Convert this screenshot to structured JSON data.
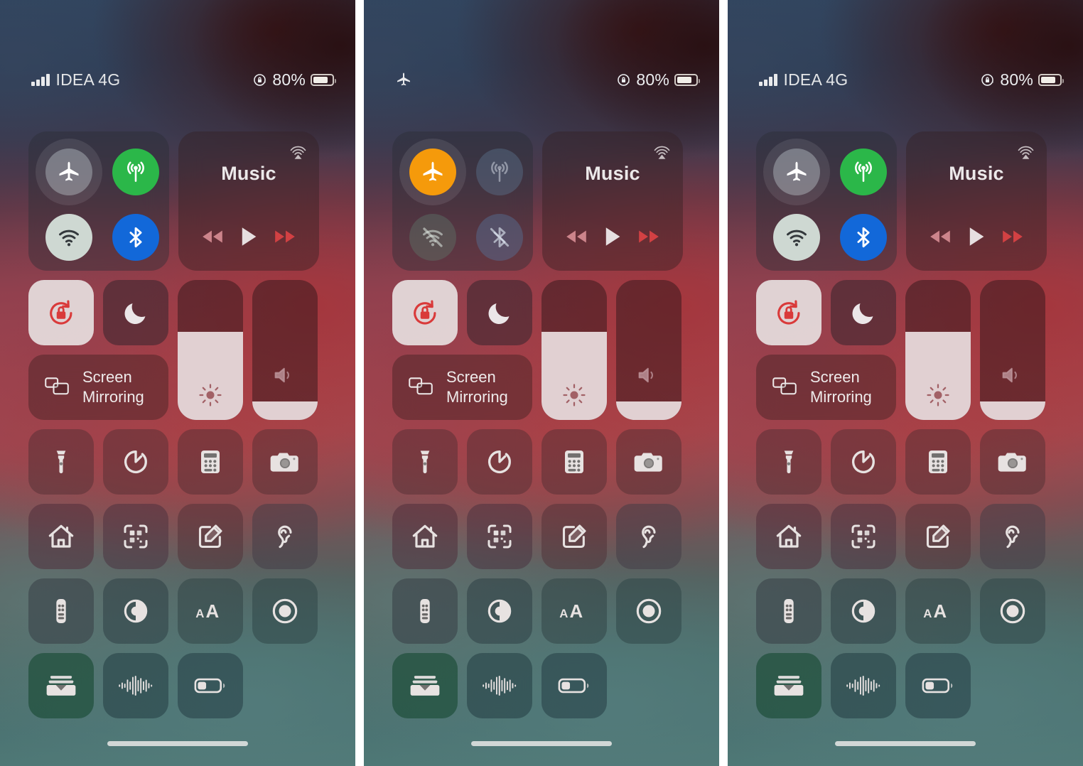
{
  "meta": {
    "title": "iOS Control Center — Airplane Mode states",
    "panel_count": 3
  },
  "colors": {
    "airplane_on": "#F59A0B",
    "cellular_on": "#2BB749",
    "wifi_on": "#ced8d2",
    "bluetooth_on": "#1268D9",
    "rotation_lock_red": "#D93A3A",
    "slider_fill": "#EEE2E4",
    "status_text": "#E9EAEC"
  },
  "panels": [
    {
      "id": "panel-before",
      "status_bar": {
        "carrier": "IDEA 4G",
        "signal_bars": 4,
        "show_airplane_icon": false,
        "rotation_lock_icon": "rotation-lock-icon",
        "battery_percent": "80%",
        "battery_fill": 80
      },
      "connectivity": {
        "airplane": {
          "label": "Airplane Mode",
          "state": "off",
          "icon": "airplane-icon"
        },
        "cellular": {
          "label": "Cellular Data",
          "state": "on",
          "icon": "cellular-icon"
        },
        "wifi": {
          "label": "Wi-Fi",
          "state": "on",
          "icon": "wifi-icon"
        },
        "bluetooth": {
          "label": "Bluetooth",
          "state": "on",
          "icon": "bluetooth-icon"
        }
      }
    },
    {
      "id": "panel-airplane-on",
      "status_bar": {
        "carrier": "",
        "signal_bars": 0,
        "show_airplane_icon": true,
        "rotation_lock_icon": "rotation-lock-icon",
        "battery_percent": "80%",
        "battery_fill": 80
      },
      "connectivity": {
        "airplane": {
          "label": "Airplane Mode",
          "state": "on",
          "icon": "airplane-icon"
        },
        "cellular": {
          "label": "Cellular Data",
          "state": "off",
          "icon": "cellular-icon"
        },
        "wifi": {
          "label": "Wi-Fi",
          "state": "off",
          "icon": "wifi-slash-icon"
        },
        "bluetooth": {
          "label": "Bluetooth",
          "state": "off",
          "icon": "bluetooth-slash-icon"
        }
      }
    },
    {
      "id": "panel-after",
      "status_bar": {
        "carrier": "IDEA 4G",
        "signal_bars": 4,
        "show_airplane_icon": false,
        "rotation_lock_icon": "rotation-lock-icon",
        "battery_percent": "80%",
        "battery_fill": 80
      },
      "connectivity": {
        "airplane": {
          "label": "Airplane Mode",
          "state": "off",
          "icon": "airplane-icon"
        },
        "cellular": {
          "label": "Cellular Data",
          "state": "on",
          "icon": "cellular-icon"
        },
        "wifi": {
          "label": "Wi-Fi",
          "state": "on",
          "icon": "wifi-icon"
        },
        "bluetooth": {
          "label": "Bluetooth",
          "state": "on",
          "icon": "bluetooth-icon"
        }
      }
    }
  ],
  "music": {
    "title": "Music",
    "airplay_icon": "airplay-audio-icon",
    "controls": [
      {
        "name": "rewind-button",
        "icon": "rewind-icon"
      },
      {
        "name": "play-button",
        "icon": "play-icon"
      },
      {
        "name": "fastforward-button",
        "icon": "fastforward-icon"
      }
    ]
  },
  "toggles": {
    "rotation_lock": {
      "label": "Portrait Orientation Lock",
      "state": "on",
      "icon": "rotation-lock-icon"
    },
    "do_not_disturb": {
      "label": "Do Not Disturb",
      "state": "off",
      "icon": "moon-icon"
    },
    "screen_mirroring": {
      "line1": "Screen",
      "line2": "Mirroring",
      "icon": "screen-mirroring-icon"
    }
  },
  "sliders": {
    "brightness": {
      "label": "Brightness",
      "value": 63,
      "icon": "brightness-icon"
    },
    "volume": {
      "label": "Volume",
      "value": 13,
      "icon": "volume-icon"
    }
  },
  "tiles": [
    {
      "name": "flashlight-tile",
      "icon": "flashlight-icon",
      "label": "Flashlight",
      "variant": "v-flash"
    },
    {
      "name": "timer-tile",
      "icon": "timer-icon",
      "label": "Timer",
      "variant": "v-timer"
    },
    {
      "name": "calculator-tile",
      "icon": "calculator-icon",
      "label": "Calculator",
      "variant": "v-calc"
    },
    {
      "name": "camera-tile",
      "icon": "camera-icon",
      "label": "Camera",
      "variant": "v-cam"
    },
    {
      "name": "home-tile",
      "icon": "home-icon",
      "label": "Home",
      "variant": "v-home"
    },
    {
      "name": "qr-scanner-tile",
      "icon": "qr-code-icon",
      "label": "Scan QR Code",
      "variant": "v-qr"
    },
    {
      "name": "notes-tile",
      "icon": "note-pencil-icon",
      "label": "Notes",
      "variant": "v-note"
    },
    {
      "name": "hearing-tile",
      "icon": "ear-icon",
      "label": "Hearing",
      "variant": "v-ear"
    },
    {
      "name": "apple-tv-remote-tile",
      "icon": "remote-icon",
      "label": "Apple TV Remote",
      "variant": "v-remote"
    },
    {
      "name": "dark-mode-tile",
      "icon": "dark-mode-icon",
      "label": "Dark Mode",
      "variant": "v-dark"
    },
    {
      "name": "text-size-tile",
      "icon": "text-size-icon",
      "label": "Text Size",
      "variant": "v-text"
    },
    {
      "name": "screen-record-tile",
      "icon": "screen-record-icon",
      "label": "Screen Recording",
      "variant": "v-rec"
    },
    {
      "name": "wallet-tile",
      "icon": "wallet-icon",
      "label": "Wallet",
      "variant": "v-wallet"
    },
    {
      "name": "sound-recognition-tile",
      "icon": "sound-wave-icon",
      "label": "Sound Recognition",
      "variant": "v-shazam"
    },
    {
      "name": "low-power-mode-tile",
      "icon": "battery-icon",
      "label": "Low Power Mode",
      "variant": "v-batt"
    }
  ],
  "home_indicator": {
    "name": "home-indicator"
  }
}
